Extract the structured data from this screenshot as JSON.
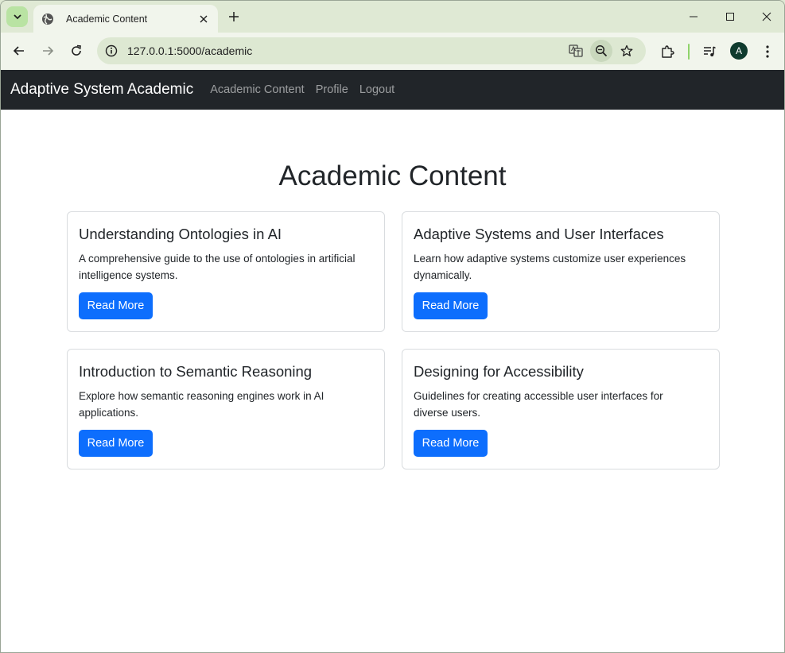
{
  "browser": {
    "tab_title": "Academic Content",
    "url": "127.0.0.1:5000/academic",
    "profile_initial": "A"
  },
  "site": {
    "brand": "Adaptive System Academic",
    "nav": [
      "Academic Content",
      "Profile",
      "Logout"
    ]
  },
  "page": {
    "title": "Academic Content",
    "cards": [
      {
        "title": "Understanding Ontologies in AI",
        "text": "A comprehensive guide to the use of ontologies in artificial intelligence systems.",
        "button": "Read More"
      },
      {
        "title": "Adaptive Systems and User Interfaces",
        "text": "Learn how adaptive systems customize user experiences dynamically.",
        "button": "Read More"
      },
      {
        "title": "Introduction to Semantic Reasoning",
        "text": "Explore how semantic reasoning engines work in AI applications.",
        "button": "Read More"
      },
      {
        "title": "Designing for Accessibility",
        "text": "Guidelines for creating accessible user interfaces for diverse users.",
        "button": "Read More"
      }
    ]
  },
  "colors": {
    "navbar": "#212529",
    "primary_button": "#0d6efd",
    "browser_frame": "#dfe9d4"
  }
}
